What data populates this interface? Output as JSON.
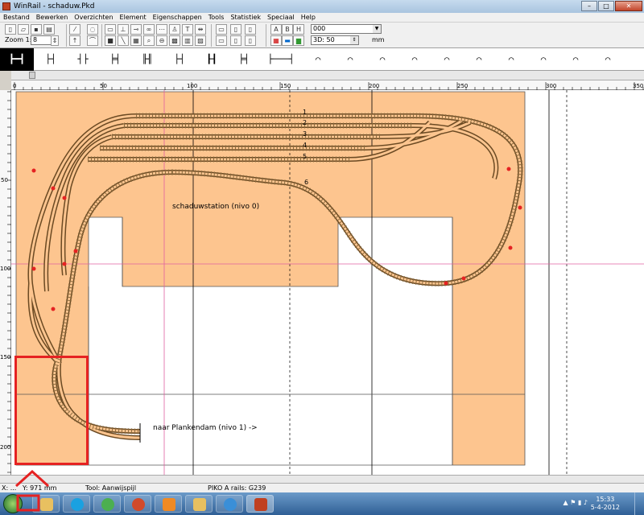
{
  "window": {
    "title": "WinRail - schaduw.Pkd"
  },
  "menu": [
    "Bestand",
    "Bewerken",
    "Overzichten",
    "Element",
    "Eigenschappen",
    "Tools",
    "Statistiek",
    "Speciaal",
    "Help"
  ],
  "toolbar": {
    "zoom_label": "Zoom 1:",
    "zoom_value": "8",
    "layer_value": "000",
    "view3d_value": "3D: 50",
    "unit": "mm",
    "text_buttons": [
      "A",
      "B",
      "H"
    ]
  },
  "ruler": {
    "h_labels": [
      "0",
      "50",
      "100",
      "150",
      "200",
      "250",
      "300",
      "350"
    ],
    "v_labels": [
      "50",
      "100",
      "150",
      "200"
    ]
  },
  "plan": {
    "track_numbers": [
      "1",
      "2",
      "3",
      "4",
      "5",
      "6"
    ],
    "label_shadow": "schaduwstation (nivo 0)",
    "label_exit": "naar Plankendam (nivo 1) ->"
  },
  "status": {
    "x": "X: ...",
    "y": "Y: 971 mm",
    "tool": "Tool: Aanwijspijl",
    "rails": "PIKO A rails: G239"
  },
  "taskbar": {
    "time": "15:33",
    "date": "5-4-2012"
  },
  "colors": {
    "baseboard": "#fdc58f",
    "track": "#6b4a23",
    "sleeper": "#8a6a3c",
    "highlight": "#e52222"
  }
}
